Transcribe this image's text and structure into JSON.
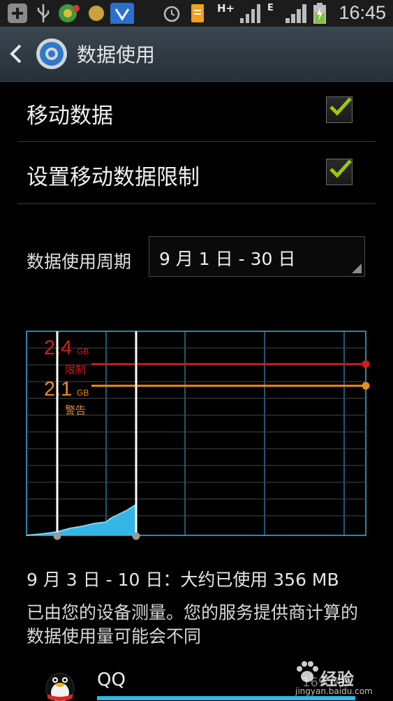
{
  "status_bar": {
    "time": "16:45",
    "network_type": "H+",
    "secondary_network": "E",
    "icons": [
      "plus-icon",
      "usb-icon",
      "app-notification-icon",
      "circle-notification-icon",
      "shield-app-icon",
      "alarm-icon",
      "file-icon",
      "signal-icon",
      "battery-charging-icon"
    ]
  },
  "action_bar": {
    "title": "数据使用",
    "back_icon": "back-arrow-icon",
    "app_icon": "settings-gear-icon"
  },
  "settings": {
    "mobile_data": {
      "label": "移动数据",
      "checked": true
    },
    "data_limit": {
      "label": "设置移动数据限制",
      "checked": true
    }
  },
  "cycle": {
    "label": "数据使用周期",
    "value": "9 月 1 日 - 30 日"
  },
  "chart": {
    "limit": {
      "value": "2.4",
      "unit": "GB",
      "label": "限制",
      "color": "#cc1f1f"
    },
    "warning": {
      "value": "2.1",
      "unit": "GB",
      "label": "警告",
      "color": "#f08a1c"
    },
    "grid_color": "#33b5e5",
    "fill_color": "#33b5e5"
  },
  "summary": "9 月 3 日 - 10 日：大约已使用 356 MB",
  "note": "已由您的设备测量。您的服务提供商计算的数据使用量可能会不同",
  "apps": [
    {
      "name": "QQ",
      "usage": "169 MB",
      "icon": "qq-penguin-icon"
    }
  ],
  "watermark": {
    "brand": "经验",
    "url": "jingyan.baidu.com"
  }
}
